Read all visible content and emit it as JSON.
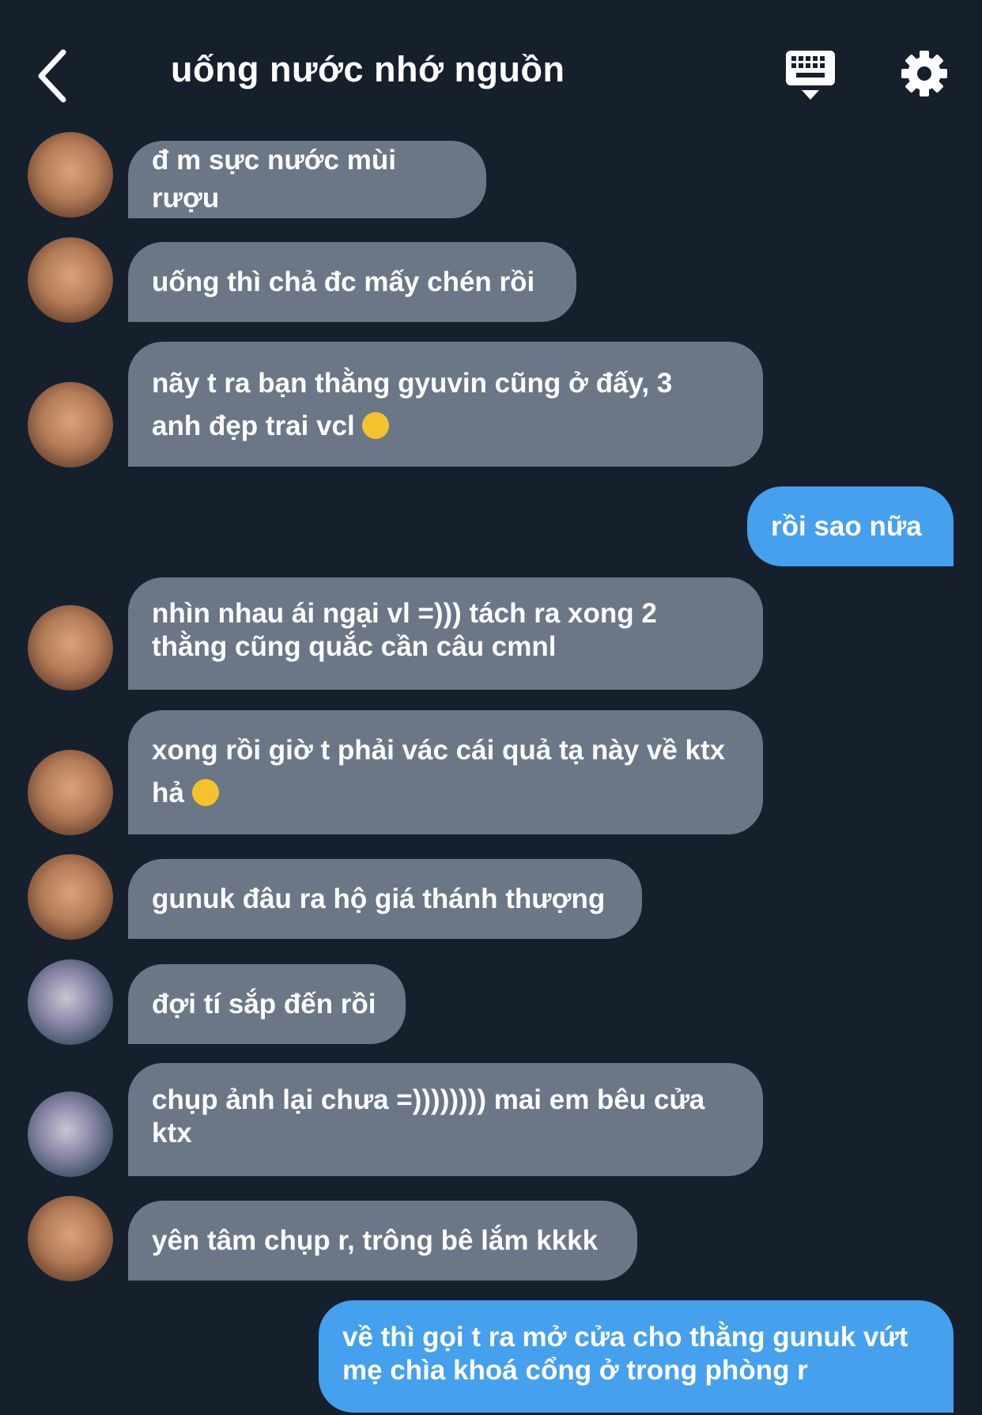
{
  "header": {
    "title": "uống nước nhớ nguồn"
  },
  "messages": [
    {
      "text": "đ m sực nước mùi rượu"
    },
    {
      "text": "uống thì chả đc mấy chén rồi"
    },
    {
      "line1": "nãy t ra bạn thằng gyuvin cũng ở đấy, 3",
      "line2": "anh đẹp trai vcl"
    },
    {
      "text": "rồi sao nữa"
    },
    {
      "line1": "nhìn nhau ái ngại vl =))) tách ra xong 2",
      "line2": "thằng cũng quắc cần câu cmnl"
    },
    {
      "line1": "xong rồi giờ t phải vác cái quả tạ này về ktx",
      "line2": "hả"
    },
    {
      "text": "gunuk đâu ra hộ giá thánh thượng"
    },
    {
      "text": "đợi tí sắp đến rồi"
    },
    {
      "line1": "chụp ảnh lại chưa =)))))))) mai em bêu cửa",
      "line2": "ktx"
    },
    {
      "text": "yên tâm chụp r, trông bê lắm kkkk"
    },
    {
      "line1": "về thì gọi t ra mở cửa cho thằng gunuk vứt",
      "line2": "mẹ chìa khoá cổng ở trong phòng r"
    }
  ],
  "colors": {
    "background": "#16202d",
    "incoming_bubble": "#6b7786",
    "outgoing_bubble": "#45a0ee"
  },
  "icons": {
    "back": "chevron-left-icon",
    "keyboard": "keyboard-icon",
    "settings": "gear-icon"
  }
}
